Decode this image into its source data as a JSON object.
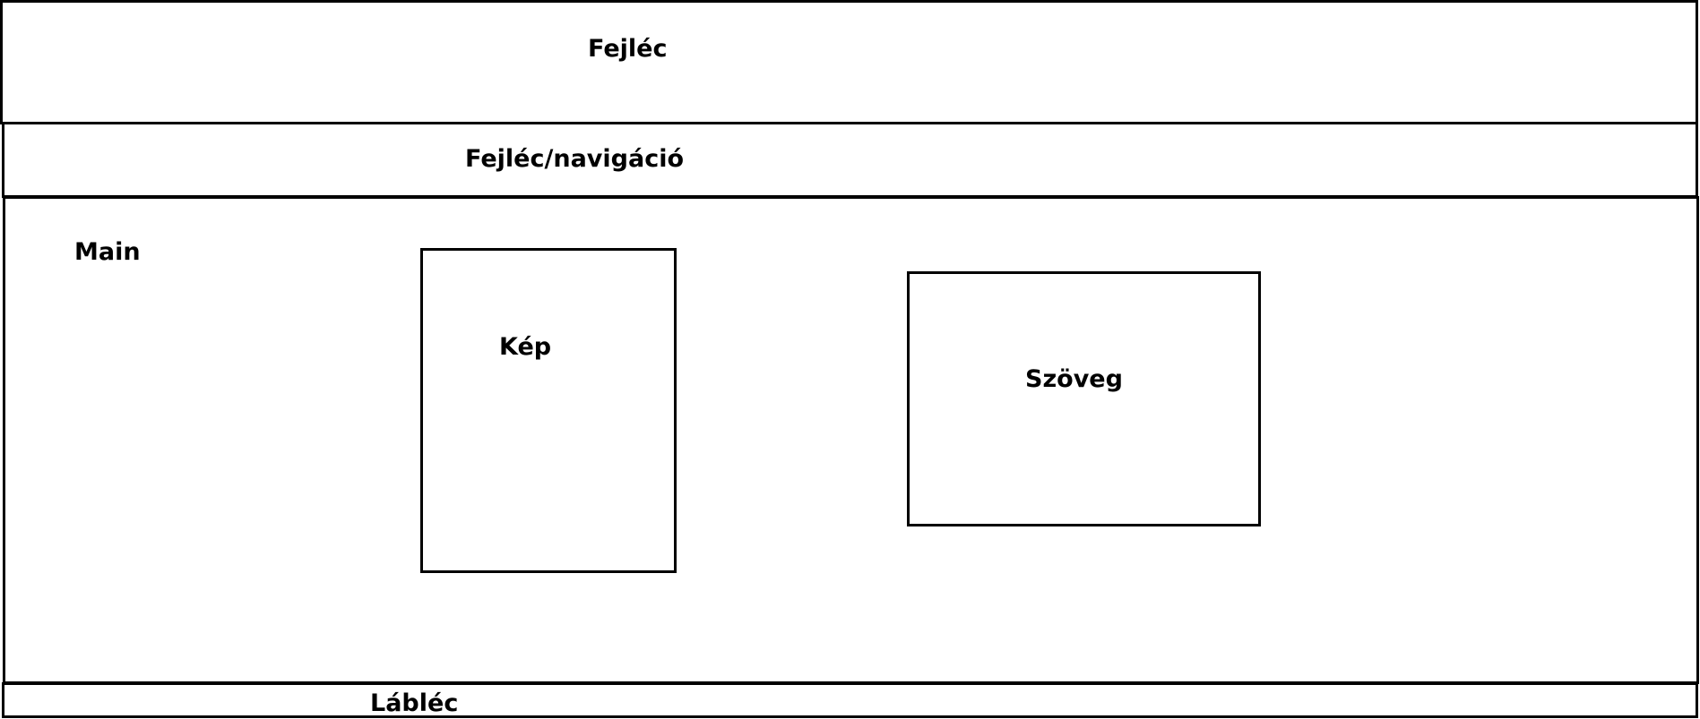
{
  "wireframe": {
    "header": {
      "label": "Fejléc"
    },
    "nav": {
      "label": "Fejléc/navigáció"
    },
    "main": {
      "label": "Main",
      "image": {
        "label": "Kép"
      },
      "text": {
        "label": "Szöveg"
      }
    },
    "footer": {
      "label": "Lábléc"
    }
  }
}
